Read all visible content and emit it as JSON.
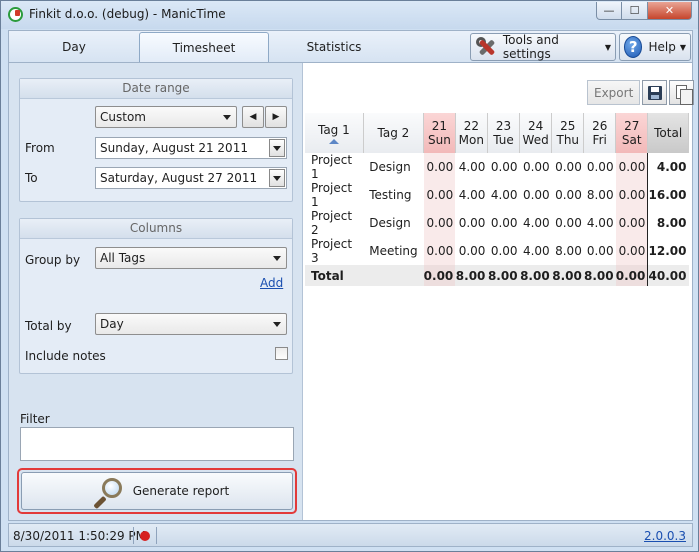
{
  "window": {
    "title": "Finkit d.o.o. (debug) - ManicTime",
    "minimize": "—",
    "maximize": "☐",
    "close": "✕"
  },
  "tabs": [
    {
      "label": "Day"
    },
    {
      "label": "Timesheet"
    },
    {
      "label": "Statistics"
    }
  ],
  "toolbar": {
    "tools_label": "Tools and settings",
    "help_label": "Help",
    "help_glyph": "?"
  },
  "date_range": {
    "header": "Date range",
    "preset": "Custom",
    "prev_glyph": "◀",
    "next_glyph": "▶",
    "from_label": "From",
    "from_value": "Sunday, August 21 2011",
    "to_label": "To",
    "to_value": "Saturday, August 27 2011"
  },
  "columns": {
    "header": "Columns",
    "group_by_label": "Group by",
    "group_by_value": "All Tags",
    "add_link": "Add",
    "total_by_label": "Total by",
    "total_by_value": "Day",
    "include_notes_label": "Include notes"
  },
  "filter": {
    "label": "Filter"
  },
  "generate_label": "Generate report",
  "export": {
    "label": "Export"
  },
  "report": {
    "headers": [
      "Tag 1",
      "Tag 2"
    ],
    "days": [
      {
        "num": "21",
        "name": "Sun"
      },
      {
        "num": "22",
        "name": "Mon"
      },
      {
        "num": "23",
        "name": "Tue"
      },
      {
        "num": "24",
        "name": "Wed"
      },
      {
        "num": "25",
        "name": "Thu"
      },
      {
        "num": "26",
        "name": "Fri"
      },
      {
        "num": "27",
        "name": "Sat"
      }
    ],
    "total_header": "Total",
    "rows": [
      {
        "tag1": "Project 1",
        "tag2": "Design",
        "values": [
          "0.00",
          "4.00",
          "0.00",
          "0.00",
          "0.00",
          "0.00",
          "0.00"
        ],
        "total": "4.00"
      },
      {
        "tag1": "Project 1",
        "tag2": "Testing",
        "values": [
          "0.00",
          "4.00",
          "4.00",
          "0.00",
          "0.00",
          "8.00",
          "0.00"
        ],
        "total": "16.00"
      },
      {
        "tag1": "Project 2",
        "tag2": "Design",
        "values": [
          "0.00",
          "0.00",
          "0.00",
          "4.00",
          "0.00",
          "4.00",
          "0.00"
        ],
        "total": "8.00"
      },
      {
        "tag1": "Project 3",
        "tag2": "Meeting",
        "values": [
          "0.00",
          "0.00",
          "0.00",
          "4.00",
          "8.00",
          "0.00",
          "0.00"
        ],
        "total": "12.00"
      }
    ],
    "grand": {
      "label": "Total",
      "values": [
        "0.00",
        "8.00",
        "8.00",
        "8.00",
        "8.00",
        "8.00",
        "0.00"
      ],
      "total": "40.00"
    }
  },
  "status": {
    "timestamp": "8/30/2011 1:50:29 PM",
    "version": "2.0.0.3"
  }
}
